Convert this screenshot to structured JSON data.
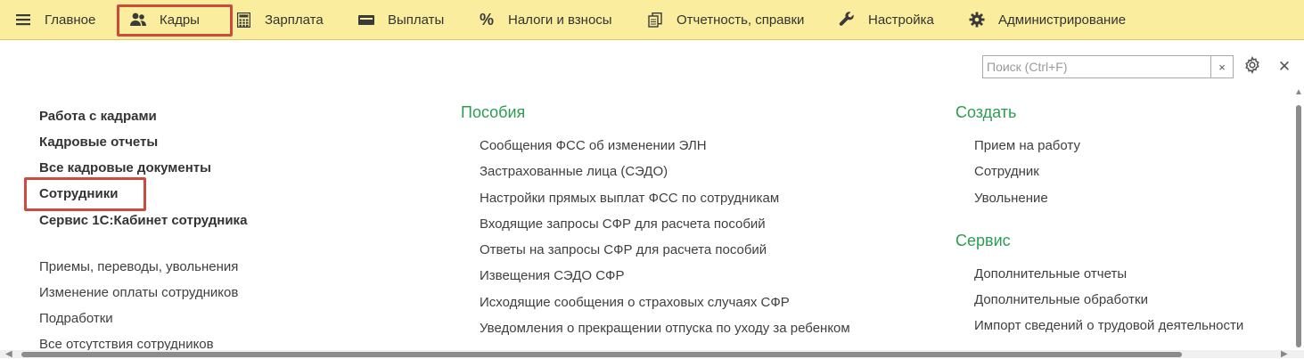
{
  "menu": {
    "items": [
      {
        "label": "Главное",
        "icon": "hamburger-icon"
      },
      {
        "label": "Кадры",
        "icon": "people-icon",
        "highlighted": true
      },
      {
        "label": "Зарплата",
        "icon": "calculator-icon"
      },
      {
        "label": "Выплаты",
        "icon": "wallet-icon"
      },
      {
        "label": "Налоги и взносы",
        "icon": "percent-icon"
      },
      {
        "label": "Отчетность, справки",
        "icon": "documents-icon"
      },
      {
        "label": "Настройка",
        "icon": "wrench-icon"
      },
      {
        "label": "Администрирование",
        "icon": "gear-icon"
      }
    ]
  },
  "search": {
    "placeholder": "Поиск (Ctrl+F)",
    "value": "",
    "clear_label": "×"
  },
  "controls": {
    "close_label": "✕"
  },
  "left": {
    "bold_links": [
      {
        "label": "Работа с кадрами"
      },
      {
        "label": "Кадровые отчеты"
      },
      {
        "label": "Все кадровые документы"
      },
      {
        "label": "Сотрудники",
        "highlighted": true
      },
      {
        "label": "Сервис 1С:Кабинет сотрудника"
      }
    ],
    "links": [
      {
        "label": "Приемы, переводы, увольнения"
      },
      {
        "label": "Изменение оплаты сотрудников"
      },
      {
        "label": "Подработки"
      },
      {
        "label": "Все отсутствия сотрудников"
      }
    ]
  },
  "middle": {
    "title": "Пособия",
    "links": [
      {
        "label": "Сообщения ФСС об изменении ЭЛН"
      },
      {
        "label": "Застрахованные лица (СЭДО)"
      },
      {
        "label": "Настройки прямых выплат ФСС по сотрудникам"
      },
      {
        "label": "Входящие запросы СФР для расчета пособий"
      },
      {
        "label": "Ответы на запросы СФР для расчета пособий"
      },
      {
        "label": "Извещения СЭДО СФР"
      },
      {
        "label": "Исходящие сообщения о страховых случаях СФР"
      },
      {
        "label": "Уведомления о прекращении отпуска по уходу за ребенком"
      }
    ]
  },
  "right": {
    "create": {
      "title": "Создать",
      "links": [
        {
          "label": "Прием на работу"
        },
        {
          "label": "Сотрудник"
        },
        {
          "label": "Увольнение"
        }
      ]
    },
    "service": {
      "title": "Сервис",
      "links": [
        {
          "label": "Дополнительные отчеты"
        },
        {
          "label": "Дополнительные обработки"
        },
        {
          "label": "Импорт сведений о трудовой деятельности"
        }
      ]
    }
  },
  "colors": {
    "menu_bg": "#fbed9e",
    "section_title": "#2d9c52",
    "highlight": "#cc4b3c"
  }
}
